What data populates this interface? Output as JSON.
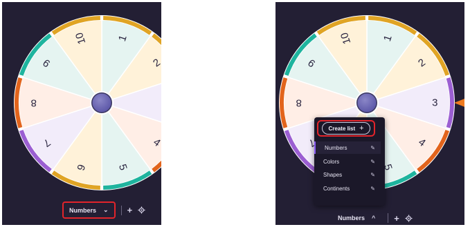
{
  "wheel": {
    "labels": [
      "1",
      "2",
      "3",
      "4",
      "5",
      "6",
      "7",
      "8",
      "9",
      "10"
    ],
    "slice_colors": [
      "#e5f4f1",
      "#fff2d9",
      "#f2ecfa",
      "#ffeee6",
      "#e5f4f1",
      "#fff2d9",
      "#f2ecfa",
      "#ffeee6",
      "#e5f4f1",
      "#fff2d9"
    ],
    "rim_colors": [
      "#e0a424",
      "#e0a424",
      "#9b5fd2",
      "#e2641c",
      "#1eb49e",
      "#e0a424",
      "#9b5fd2",
      "#e2641c",
      "#1eb49e",
      "#e0a424"
    ],
    "pointer_color": "#ef7a1f",
    "hub_gradient": [
      "#8a86c7",
      "#5a55a6"
    ]
  },
  "left_panel": {
    "list_button_label": "Numbers",
    "list_button_chevron": "⌄",
    "add_icon": "+",
    "settings_icon": "gear-icon"
  },
  "right_panel": {
    "list_button_label": "Numbers",
    "list_button_chevron": "^",
    "add_icon": "+",
    "settings_icon": "gear-icon",
    "menu": {
      "create_label": "Create list",
      "create_icon": "+",
      "items": [
        {
          "label": "Numbers",
          "active": true
        },
        {
          "label": "Colors",
          "active": false
        },
        {
          "label": "Shapes",
          "active": false
        },
        {
          "label": "Continents",
          "active": false
        }
      ],
      "edit_icon": "pencil-icon"
    }
  }
}
